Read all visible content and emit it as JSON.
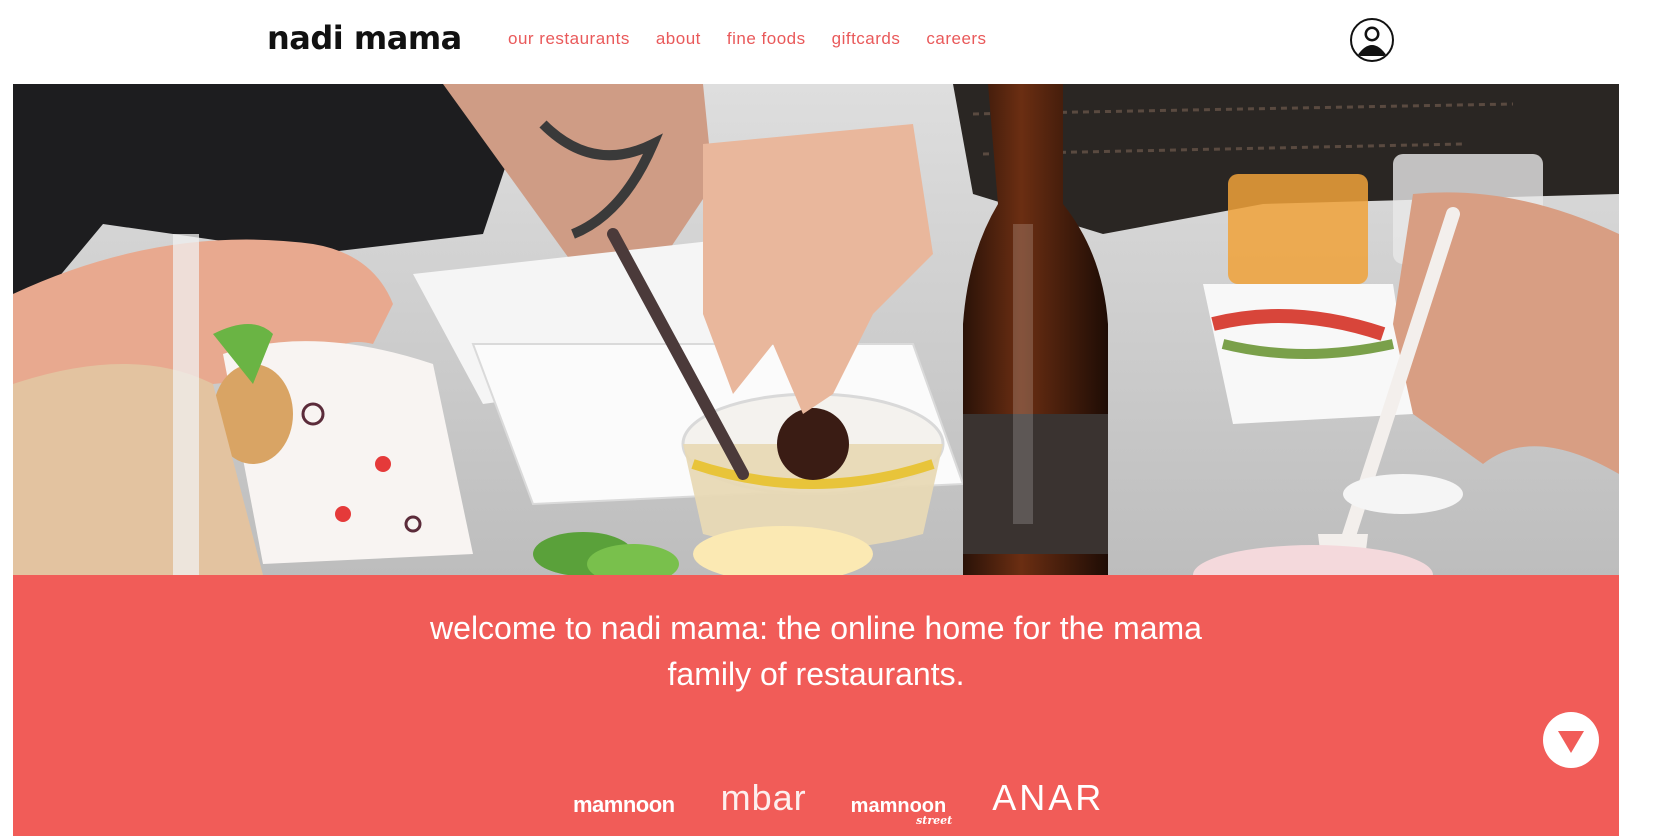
{
  "header": {
    "logo": "nadi mama",
    "nav": [
      "our restaurants",
      "about",
      "fine foods",
      "giftcards",
      "careers"
    ],
    "account_icon": "user-account-icon"
  },
  "hero": {
    "image": "people sharing takeout food: falafel, hummus, bottle, salads"
  },
  "welcome": {
    "line1": "welcome to nadi mama: the online home for the mama",
    "line2": "family of restaurants."
  },
  "brands": [
    "mamnoon",
    "mbar",
    "mamnoon",
    "ANAR"
  ],
  "brand_street_sub": "street",
  "scroll_icon": "chevron-down-icon",
  "colors": {
    "accent": "#f15c58",
    "nav_text": "#e9595a",
    "logo": "#111111"
  }
}
